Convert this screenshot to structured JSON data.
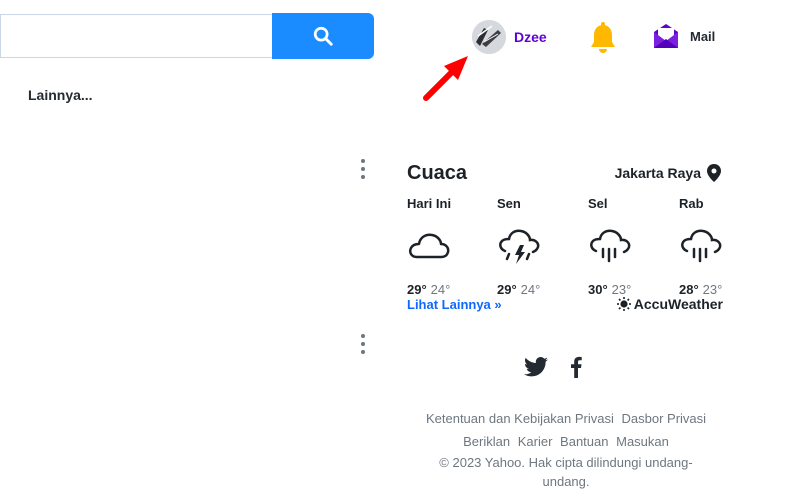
{
  "search": {
    "placeholder": "",
    "value": ""
  },
  "left": {
    "more_label": "Lainnya..."
  },
  "header": {
    "user_name": "Dzee",
    "mail_label": "Mail"
  },
  "weather": {
    "title": "Cuaca",
    "location": "Jakarta Raya",
    "days": [
      {
        "name": "Hari Ini",
        "icon": "cloud-icon",
        "hi": "29°",
        "lo": "24°"
      },
      {
        "name": "Sen",
        "icon": "thunderstorm-icon",
        "hi": "29°",
        "lo": "24°"
      },
      {
        "name": "Sel",
        "icon": "rain-icon",
        "hi": "30°",
        "lo": "23°"
      },
      {
        "name": "Rab",
        "icon": "rain-icon",
        "hi": "28°",
        "lo": "23°"
      }
    ],
    "see_more": "Lihat Lainnya »",
    "provider": "AccuWeather"
  },
  "footer": {
    "links_row1": [
      "Ketentuan dan Kebijakan Privasi",
      "Dasbor Privasi"
    ],
    "links_row2": [
      "Beriklan",
      "Karier",
      "Bantuan",
      "Masukan"
    ],
    "copyright": "© 2023 Yahoo. Hak cipta dilindungi undang-undang."
  },
  "colors": {
    "accent": "#1a8cff",
    "user": "#5f01d1",
    "link": "#0f69ff",
    "bell": "#ffb800",
    "mail": "#6001d2",
    "arrow": "#ff0000"
  }
}
